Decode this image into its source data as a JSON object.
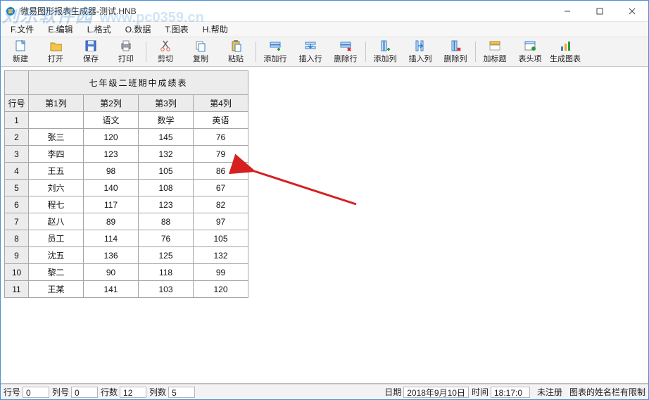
{
  "window": {
    "title": "微易图形报表生成器-测试.HNB"
  },
  "watermark": {
    "brand": "刘乐软件园",
    "url": "www.pc0359.cn"
  },
  "menubar": [
    "F.文件",
    "E.编辑",
    "L.格式",
    "O.数据",
    "T.图表",
    "H.帮助"
  ],
  "toolbar": [
    {
      "label": "新建",
      "icon": "new-icon"
    },
    {
      "label": "打开",
      "icon": "open-icon"
    },
    {
      "label": "保存",
      "icon": "save-icon"
    },
    {
      "label": "打印",
      "icon": "print-icon"
    },
    {
      "sep": true
    },
    {
      "label": "剪切",
      "icon": "cut-icon"
    },
    {
      "label": "复制",
      "icon": "copy-icon"
    },
    {
      "label": "粘贴",
      "icon": "paste-icon"
    },
    {
      "sep": true
    },
    {
      "label": "添加行",
      "icon": "addrow-icon"
    },
    {
      "label": "插入行",
      "icon": "insrow-icon"
    },
    {
      "label": "删除行",
      "icon": "delrow-icon"
    },
    {
      "sep": true
    },
    {
      "label": "添加列",
      "icon": "addcol-icon"
    },
    {
      "label": "插入列",
      "icon": "inscol-icon"
    },
    {
      "label": "删除列",
      "icon": "delcol-icon"
    },
    {
      "sep": true
    },
    {
      "label": "加标题",
      "icon": "title-icon"
    },
    {
      "label": "表头项",
      "icon": "header-icon"
    },
    {
      "label": "生成图表",
      "icon": "chart-icon"
    }
  ],
  "sheet": {
    "title": "七年级二班期中成绩表",
    "rowHeader": "行号",
    "colHeaders": [
      "第1列",
      "第2列",
      "第3列",
      "第4列"
    ],
    "rows": [
      {
        "n": "1",
        "c": [
          "",
          "语文",
          "数学",
          "英语"
        ]
      },
      {
        "n": "2",
        "c": [
          "张三",
          "120",
          "145",
          "76"
        ]
      },
      {
        "n": "3",
        "c": [
          "李四",
          "123",
          "132",
          "79"
        ]
      },
      {
        "n": "4",
        "c": [
          "王五",
          "98",
          "105",
          "86"
        ]
      },
      {
        "n": "5",
        "c": [
          "刘六",
          "140",
          "108",
          "67"
        ]
      },
      {
        "n": "6",
        "c": [
          "程七",
          "117",
          "123",
          "82"
        ]
      },
      {
        "n": "7",
        "c": [
          "赵八",
          "89",
          "88",
          "97"
        ]
      },
      {
        "n": "8",
        "c": [
          "员工",
          "114",
          "76",
          "105"
        ]
      },
      {
        "n": "9",
        "c": [
          "沈五",
          "136",
          "125",
          "132"
        ]
      },
      {
        "n": "10",
        "c": [
          "黎二",
          "90",
          "118",
          "99"
        ]
      },
      {
        "n": "11",
        "c": [
          "王某",
          "141",
          "103",
          "120"
        ]
      }
    ]
  },
  "status": {
    "rowLabel": "行号",
    "rowVal": "0",
    "colLabel": "列号",
    "colVal": "0",
    "rowsLabel": "行数",
    "rowsVal": "12",
    "colsLabel": "列数",
    "colsVal": "5",
    "dateLabel": "日期",
    "dateVal": "2018年9月10日",
    "timeLabel": "时间",
    "timeVal": "18:17:0",
    "reg": "未注册",
    "tip": "图表的姓名栏有限制"
  }
}
